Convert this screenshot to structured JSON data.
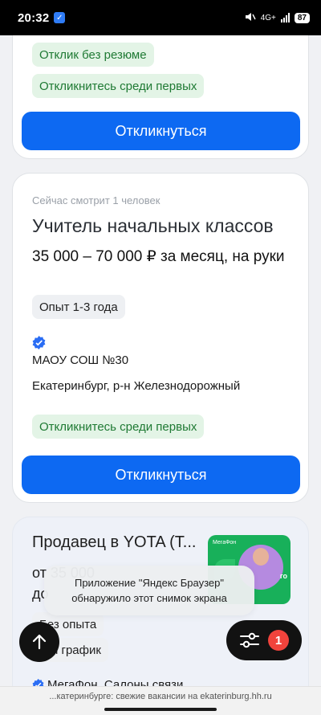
{
  "status_bar": {
    "time": "20:32",
    "network": "4G+",
    "battery": "87"
  },
  "card1": {
    "tag_no_resume": "Отклик без резюме",
    "tag_first": "Откликнитесь среди первых",
    "respond_label": "Откликнуться"
  },
  "card2": {
    "viewing": "Сейчас смотрит 1 человек",
    "title": "Учитель начальных классов",
    "salary": "35 000 – 70 000 ₽ за месяц, на руки",
    "experience": "Опыт 1-3 года",
    "company": "МАОУ СОШ №30",
    "location": "Екатеринбург, р-н Железнодорожный",
    "tag_first": "Откликнитесь среди первых",
    "respond_label": "Откликнуться"
  },
  "card3": {
    "title": "Продавец в YOTA (Т...",
    "salary_partial": "от 35 000",
    "salary_partial2": "до",
    "logo_brand": "МегаФон",
    "logo_word": "го",
    "tag_experience": "Без опыта",
    "tag_schedule": "кий график",
    "company": "МегаФон. Салоны связи"
  },
  "toast": {
    "text": "Приложение \"Яндекс Браузер\" обнаружило этот снимок экрана"
  },
  "filter": {
    "badge_count": "1"
  },
  "url_bar": {
    "text": "...катеринбурге: свежие вакансии на ekaterinburg.hh.ru"
  },
  "colors": {
    "primary_button": "#0d69f2",
    "green_tag_bg": "#e3f4e6",
    "green_tag_text": "#1f7a34",
    "badge": "#f1433c",
    "verified": "#2a6df4"
  },
  "icons": [
    "check-badge-icon",
    "signal-icon",
    "verified-icon",
    "arrow-up-icon",
    "filter-sliders-icon"
  ]
}
